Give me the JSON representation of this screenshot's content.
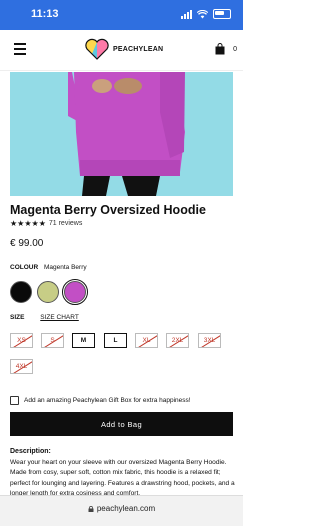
{
  "status_bar": {
    "time": "11:13"
  },
  "brand": {
    "name": "PEACHYLEAN"
  },
  "cart": {
    "count": "0"
  },
  "product": {
    "title": "Magenta Berry Oversized Hoodie",
    "stars": "★★★★★",
    "reviews": "71 reviews",
    "price": "€ 99.00"
  },
  "colour": {
    "label": "COLOUR",
    "selected": "Magenta Berry",
    "swatches": [
      {
        "name": "black",
        "color": "#0a0a0a",
        "selected": false
      },
      {
        "name": "sage",
        "color": "#c7cd86",
        "selected": false
      },
      {
        "name": "magenta",
        "color": "#c24fc5",
        "selected": true
      }
    ]
  },
  "size": {
    "label": "SIZE",
    "chart_label": "SIZE CHART",
    "options": [
      {
        "label": "XS",
        "available": false
      },
      {
        "label": "S",
        "available": false
      },
      {
        "label": "M",
        "available": true
      },
      {
        "label": "L",
        "available": true
      },
      {
        "label": "XL",
        "available": false
      },
      {
        "label": "2XL",
        "available": false
      },
      {
        "label": "3XL",
        "available": false
      },
      {
        "label": "4XL",
        "available": false
      }
    ]
  },
  "gift": {
    "label": "Add an amazing Peachylean Gift Box for extra happiness!"
  },
  "add_to_bag": "Add to Bag",
  "description": {
    "title": "Description:",
    "text": "Wear your heart on your sleeve with our oversized Magenta Berry Hoodie. Made from cosy, super soft, cotton mix fabric, this hoodie is a relaxed fit; perfect for lounging and layering. Features a drawstring hood, pockets, and a longer length for extra cosiness and comfort."
  },
  "browser": {
    "url": "peachylean.com"
  },
  "colors": {
    "accent": "#0e0e0e",
    "unavailable": "#c0392b",
    "image_bg": "#93dbe6",
    "hoodie": "#c24fc5"
  }
}
